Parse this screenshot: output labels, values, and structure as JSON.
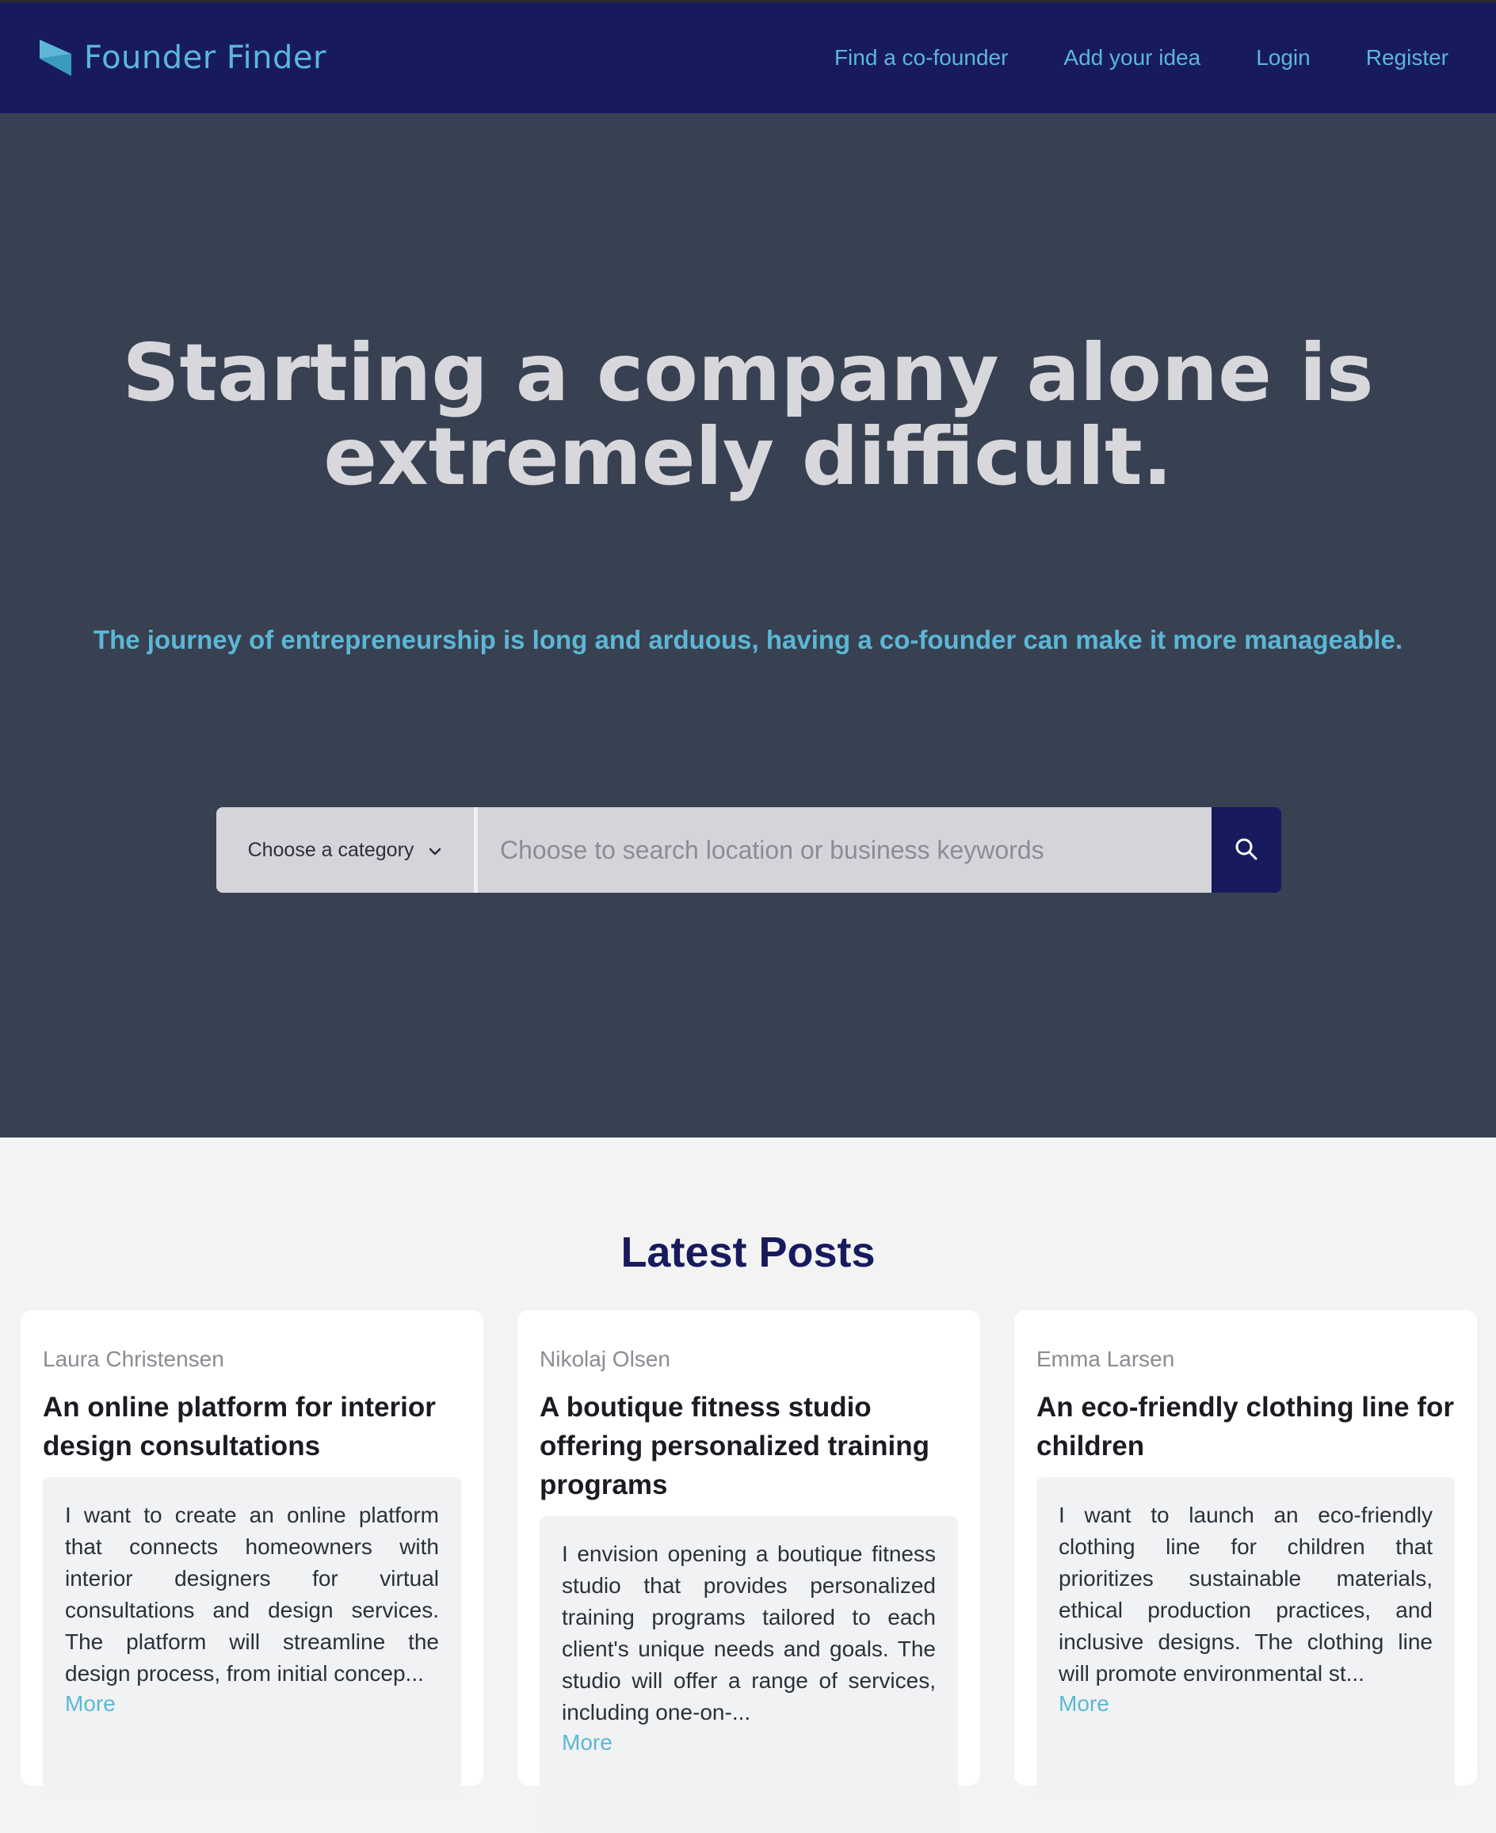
{
  "colors": {
    "header_bg": "#171b5e",
    "hero_bg": "#374152",
    "accent": "#5cb7d6",
    "hero_text": "#d8d8dc",
    "section_title": "#171b5e"
  },
  "header": {
    "brand_icon": "flag-logo-icon",
    "brand_name": "Founder Finder",
    "nav": [
      {
        "label": "Find a co-founder"
      },
      {
        "label": "Add your idea"
      },
      {
        "label": "Login"
      },
      {
        "label": "Register"
      }
    ]
  },
  "hero": {
    "title_line1": "Starting a company alone is",
    "title_line2": "extremely difficult.",
    "subtitle": "The journey of entrepreneurship is long and arduous, having a co-founder can make it more manageable."
  },
  "search": {
    "category_label": "Choose a category",
    "category_icon": "chevron-down-icon",
    "placeholder": "Choose to search location or business keywords",
    "value": "",
    "button_icon": "search-icon"
  },
  "posts": {
    "title": "Latest Posts",
    "items": [
      {
        "author": "Laura Christensen",
        "title": "An online platform for interior design consultations",
        "excerpt": "I want to create an online platform that connects homeowners with interior designers for virtual consultations and design services. The platform will streamline the design process, from initial concep...",
        "more": "More"
      },
      {
        "author": "Nikolaj Olsen",
        "title": "A boutique fitness studio offering personalized training programs",
        "excerpt": "I envision opening a boutique fitness studio that provides personalized training programs tailored to each client's unique needs and goals. The studio will offer a range of services, including one-on-...",
        "more": "More"
      },
      {
        "author": "Emma Larsen",
        "title": "An eco-friendly clothing line for children",
        "excerpt": "I want to launch an eco-friendly clothing line for children that prioritizes sustainable materials, ethical production practices, and inclusive designs. The clothing line will promote environmental st...",
        "more": "More"
      }
    ]
  }
}
